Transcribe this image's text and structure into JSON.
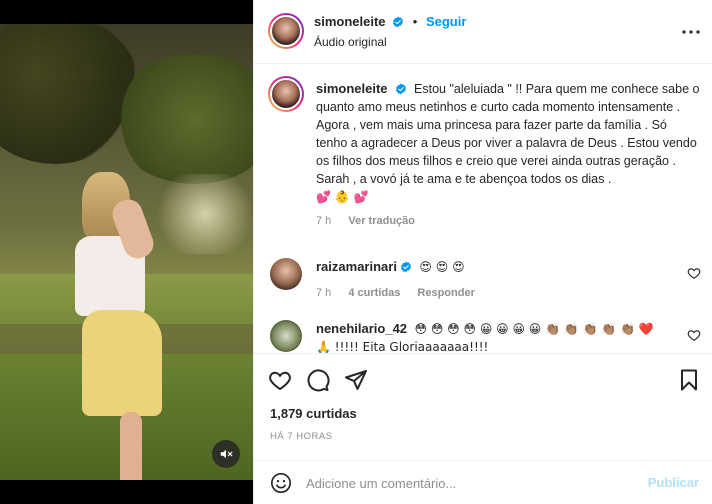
{
  "post": {
    "author": "simoneleite",
    "follow_label": "Seguir",
    "audio_label": "Áudio original",
    "verified_color": "#0095f6"
  },
  "caption": {
    "author": "simoneleite",
    "text_line1": "Estou \"aleluiada \" !! Para quem me conhece sabe o quanto amo meus netinhos e curto cada momento intensamente .",
    "text_line2": "Agora , vem mais uma princesa para fazer parte da família . Só tenho a agradecer a Deus por viver a palavra de Deus . Estou vendo os filhos dos meus filhos e creio que verei ainda outras geração . Sarah , a vovó já te ama e te abençoa todos os dias .",
    "emojis": "💕 👶 💕",
    "time": "7 h",
    "translate_label": "Ver tradução"
  },
  "comments": [
    {
      "author": "raizamarinari",
      "text": "😍 😍 😍",
      "time": "7 h",
      "likes": "4 curtidas",
      "reply_label": "Responder"
    },
    {
      "author": "nenehilario_42",
      "text": "😳 😳 😳 😳 😀 😀 😀 😀 👏🏽 👏🏽 👏🏽 👏🏽 👏🏽 ❤️",
      "text_line2": "🙏 !!!!! Eita Gloriaaaaaaa!!!!"
    }
  ],
  "stats": {
    "likes": "1,879 curtidas",
    "time_ago": "HÁ 7 HORAS"
  },
  "compose": {
    "placeholder": "Adicione um comentário...",
    "post_label": "Publicar"
  },
  "icons": {
    "like": "heart-icon",
    "comment": "comment-icon",
    "share": "paper-plane-icon",
    "save": "bookmark-icon",
    "mute": "volume-muted-icon",
    "emoji": "smiley-icon",
    "more": "more-horizontal-icon"
  }
}
